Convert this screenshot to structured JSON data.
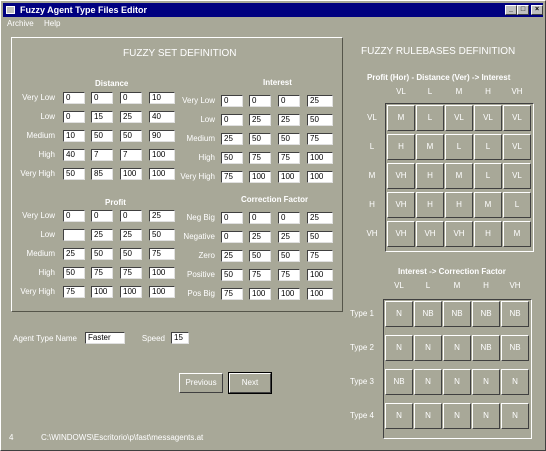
{
  "window": {
    "title": "Fuzzy Agent Type Files Editor",
    "controls": {
      "minimize": "_",
      "maximize": "□",
      "close": "×"
    }
  },
  "menu": {
    "items": [
      "Archive",
      "Help"
    ]
  },
  "fuzzy_set": {
    "title": "FUZZY SET DEFINITION",
    "distance": {
      "title": "Distance",
      "rows": [
        {
          "label": "Very Low",
          "values": [
            "0",
            "0",
            "0",
            "10"
          ]
        },
        {
          "label": "Low",
          "values": [
            "0",
            "15",
            "25",
            "40"
          ]
        },
        {
          "label": "Medium",
          "values": [
            "10",
            "50",
            "50",
            "90"
          ]
        },
        {
          "label": "High",
          "values": [
            "40",
            "7",
            "7",
            "100"
          ]
        },
        {
          "label": "Very High",
          "values": [
            "50",
            "85",
            "100",
            "100"
          ]
        }
      ]
    },
    "interest": {
      "title": "Interest",
      "rows": [
        {
          "label": "Very Low",
          "values": [
            "0",
            "0",
            "0",
            "25"
          ]
        },
        {
          "label": "Low",
          "values": [
            "0",
            "25",
            "25",
            "50"
          ]
        },
        {
          "label": "Medium",
          "values": [
            "25",
            "50",
            "50",
            "75"
          ]
        },
        {
          "label": "High",
          "values": [
            "50",
            "75",
            "75",
            "100"
          ]
        },
        {
          "label": "Very High",
          "values": [
            "75",
            "100",
            "100",
            "100"
          ]
        }
      ]
    },
    "profit": {
      "title": "Profit",
      "rows": [
        {
          "label": "Very Low",
          "values": [
            "0",
            "0",
            "0",
            "25"
          ]
        },
        {
          "label": "Low",
          "values": [
            "",
            "25",
            "25",
            "50"
          ]
        },
        {
          "label": "Medium",
          "values": [
            "25",
            "50",
            "50",
            "75"
          ]
        },
        {
          "label": "High",
          "values": [
            "50",
            "75",
            "75",
            "100"
          ]
        },
        {
          "label": "Very High",
          "values": [
            "75",
            "100",
            "100",
            "100"
          ]
        }
      ]
    },
    "correction": {
      "title": "Correction Factor",
      "rows": [
        {
          "label": "Neg Big",
          "values": [
            "0",
            "0",
            "0",
            "25"
          ]
        },
        {
          "label": "Negative",
          "values": [
            "0",
            "25",
            "25",
            "50"
          ]
        },
        {
          "label": "Zero",
          "values": [
            "25",
            "50",
            "50",
            "75"
          ]
        },
        {
          "label": "Positive",
          "values": [
            "50",
            "75",
            "75",
            "100"
          ]
        },
        {
          "label": "Pos Big",
          "values": [
            "75",
            "100",
            "100",
            "100"
          ]
        }
      ]
    }
  },
  "agent": {
    "type_name_label": "Agent Type Name",
    "type_name": "Faster",
    "speed_label": "Speed",
    "speed": "15"
  },
  "buttons": {
    "previous": "Previous",
    "next": "Next"
  },
  "status": {
    "index": "4",
    "path": "C:\\WINDOWS\\Escritorio\\p\\fast\\messagents.at"
  },
  "rulebase": {
    "title": "FUZZY RULEBASES DEFINITION",
    "matrix1": {
      "title": "Profit (Hor) - Distance (Ver) -> Interest",
      "cols": [
        "VL",
        "L",
        "M",
        "H",
        "VH"
      ],
      "rows": [
        {
          "label": "VL",
          "cells": [
            "M",
            "L",
            "VL",
            "VL",
            "VL"
          ]
        },
        {
          "label": "L",
          "cells": [
            "H",
            "M",
            "L",
            "L",
            "VL"
          ]
        },
        {
          "label": "M",
          "cells": [
            "VH",
            "H",
            "M",
            "L",
            "VL"
          ]
        },
        {
          "label": "H",
          "cells": [
            "VH",
            "H",
            "H",
            "M",
            "L"
          ]
        },
        {
          "label": "VH",
          "cells": [
            "VH",
            "VH",
            "VH",
            "H",
            "M"
          ]
        }
      ]
    },
    "matrix2": {
      "title": "Interest -> Correction Factor",
      "cols": [
        "VL",
        "L",
        "M",
        "H",
        "VH"
      ],
      "rows": [
        {
          "label": "Type 1",
          "cells": [
            "N",
            "NB",
            "NB",
            "NB",
            "NB"
          ]
        },
        {
          "label": "Type 2",
          "cells": [
            "N",
            "N",
            "N",
            "NB",
            "NB"
          ]
        },
        {
          "label": "Type 3",
          "cells": [
            "NB",
            "N",
            "N",
            "N",
            "N"
          ]
        },
        {
          "label": "Type 4",
          "cells": [
            "N",
            "N",
            "N",
            "N",
            "N"
          ]
        }
      ]
    }
  }
}
